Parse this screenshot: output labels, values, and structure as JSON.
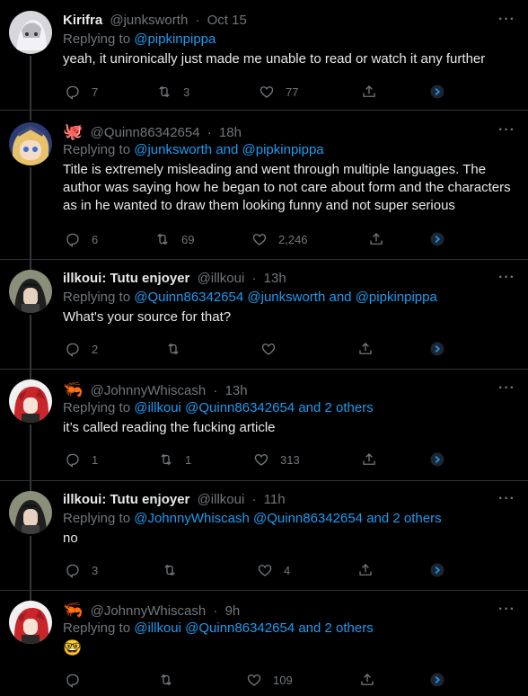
{
  "tweets": [
    {
      "name": "Kirifra",
      "handle": "@junksworth",
      "time": "Oct 15",
      "replying_prefix": "Replying to",
      "mentions": [
        "@pipkinpippa"
      ],
      "mentions_tail": "",
      "text": "yeah, it unironically just made me unable to read or watch it any further",
      "replies": "7",
      "retweets": "3",
      "likes": "77"
    },
    {
      "name_emoji": "🐙",
      "handle": "@Quinn86342654",
      "time": "18h",
      "replying_prefix": "Replying to",
      "mentions": [
        "@junksworth",
        "and",
        "@pipkinpippa"
      ],
      "mentions_tail": "",
      "text": "Title is extremely misleading and went through multiple languages. The author was saying how he began to not care about form and the characters as in he wanted to draw them looking funny and not super serious",
      "replies": "6",
      "retweets": "69",
      "likes": "2,246"
    },
    {
      "name": "illkoui: Tutu enjoyer",
      "handle": "@illkoui",
      "time": "13h",
      "replying_prefix": "Replying to",
      "mentions": [
        "@Quinn86342654",
        "@junksworth",
        "and",
        "@pipkinpippa"
      ],
      "mentions_tail": "",
      "text": "What's your source for that?",
      "replies": "2",
      "retweets": "",
      "likes": ""
    },
    {
      "name_emoji": "🦐",
      "handle": "@JohnnyWhiscash",
      "time": "13h",
      "replying_prefix": "Replying to",
      "mentions": [
        "@illkoui",
        "@Quinn86342654",
        "and 2 others"
      ],
      "mentions_tail": "",
      "text": "it’s called reading the fucking article",
      "replies": "1",
      "retweets": "1",
      "likes": "313"
    },
    {
      "name": "illkoui: Tutu enjoyer",
      "handle": "@illkoui",
      "time": "11h",
      "replying_prefix": "Replying to",
      "mentions": [
        "@JohnnyWhiscash",
        "@Quinn86342654",
        "and 2 others"
      ],
      "mentions_tail": "",
      "text": "no",
      "replies": "3",
      "retweets": "",
      "likes": "4"
    },
    {
      "name_emoji": "🦐",
      "handle": "@JohnnyWhiscash",
      "time": "9h",
      "replying_prefix": "Replying to",
      "mentions": [
        "@illkoui",
        "@Quinn86342654",
        "and 2 others"
      ],
      "mentions_tail": "",
      "text": "🤓",
      "replies": "",
      "retweets": "",
      "likes": "109"
    }
  ],
  "more_label": "···",
  "dot": "·",
  "colors": {
    "background": "#000000",
    "link": "#1d9bf0",
    "muted": "#71767b",
    "text": "#e7e9ea"
  },
  "icons": [
    "reply-icon",
    "retweet-icon",
    "like-icon",
    "share-icon",
    "analytics-icon",
    "more-icon"
  ]
}
